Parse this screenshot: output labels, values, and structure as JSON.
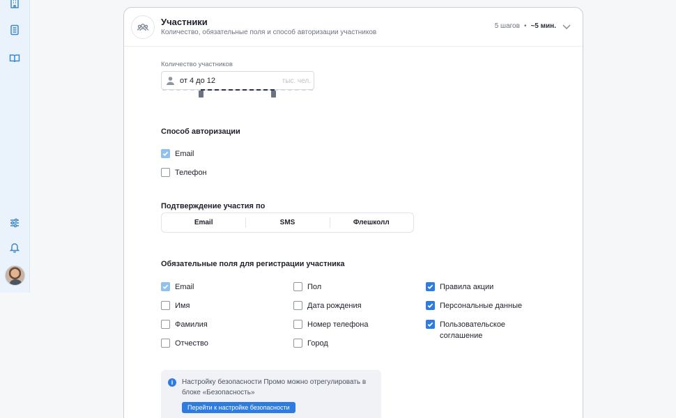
{
  "sidebar": {
    "top_icons": [
      "building-icon",
      "document-icon",
      "book-icon"
    ],
    "bottom_icons": [
      "sliders-icon",
      "bell-icon"
    ]
  },
  "header": {
    "title": "Участники",
    "subtitle": "Количество, обязательные поля и способ авторизации участников",
    "steps": "5 шагов",
    "separator": "•",
    "time": "~5 мин."
  },
  "participants": {
    "label": "Количество участников",
    "value": "от 4 до 12",
    "unit": "тыс. чел.",
    "range_min": 4,
    "range_max": 12
  },
  "auth": {
    "title": "Способ авторизации",
    "options": [
      {
        "label": "Email",
        "checked": true
      },
      {
        "label": "Телефон",
        "checked": false
      }
    ]
  },
  "confirm": {
    "title": "Подтверждение участия по",
    "options": [
      "Email",
      "SMS",
      "Флешколл"
    ]
  },
  "required": {
    "title": "Обязательные поля для регистрации участника",
    "col1": [
      {
        "label": "Email",
        "checked": true
      },
      {
        "label": "Имя",
        "checked": false
      },
      {
        "label": "Фамилия",
        "checked": false
      },
      {
        "label": "Отчество",
        "checked": false
      }
    ],
    "col2": [
      {
        "label": "Пол",
        "checked": false
      },
      {
        "label": "Дата рождения",
        "checked": false
      },
      {
        "label": "Номер телефона",
        "checked": false
      },
      {
        "label": "Город",
        "checked": false
      }
    ],
    "col3": [
      {
        "label": "Правила акции",
        "checked": true
      },
      {
        "label": "Персональные данные",
        "checked": true
      },
      {
        "label": "Пользовательское соглашение",
        "checked": true
      }
    ]
  },
  "info": {
    "text": "Настройку безопасности Промо можно отрегулировать в блоке «Безопасность»",
    "button": "Перейти к настройке безопасности"
  }
}
